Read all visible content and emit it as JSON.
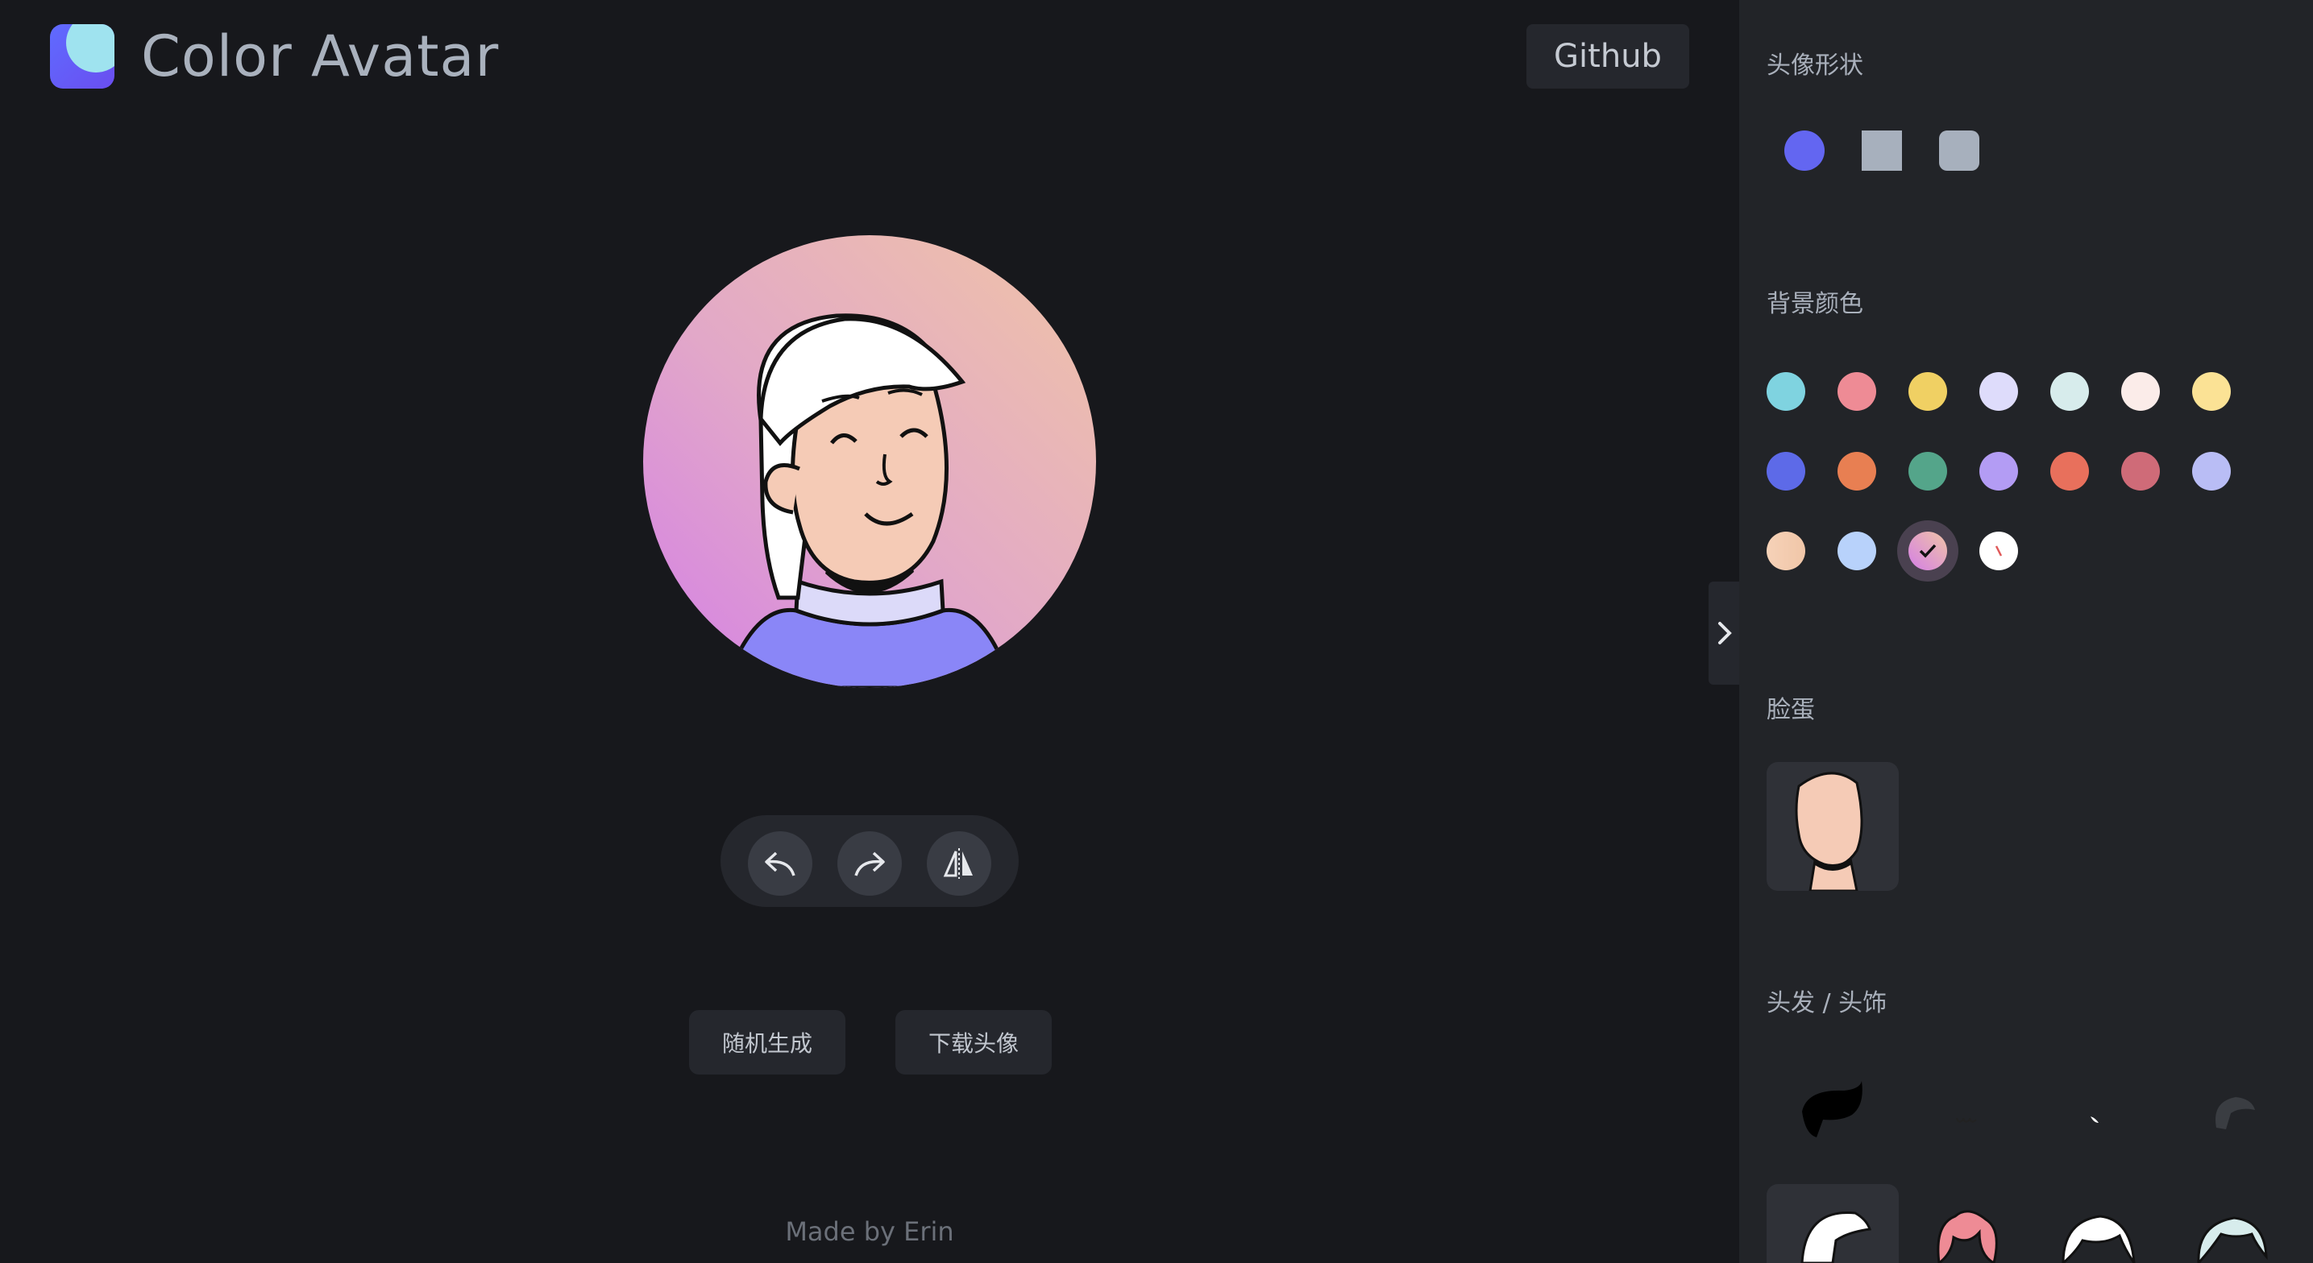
{
  "app": {
    "title": "Color Avatar",
    "github_label": "Github"
  },
  "actions": {
    "random_label": "随机生成",
    "download_label": "下载头像"
  },
  "toolbar": {
    "icons": [
      "undo-icon",
      "redo-icon",
      "flip-icon"
    ]
  },
  "footer": {
    "text": "Made by Erin"
  },
  "panel": {
    "shape_title": "头像形状",
    "shapes": [
      "circle",
      "square",
      "rounded-square"
    ],
    "selected_shape": "circle",
    "background_title": "背景颜色",
    "background_colors": [
      [
        "#7fd3e0",
        "#ee8b95",
        "#f0d063",
        "#dedcfb",
        "#d7ecec",
        "#fbece9",
        "#fbe295"
      ],
      [
        "#5d6ae8",
        "#e87f52",
        "#54a58a",
        "#b39cf4",
        "#e8705c",
        "#cf6b78",
        "#b9bdf5"
      ],
      [
        "gradient-peach",
        "#b8d2fb",
        "gradient-pink-selected",
        "transparent-white"
      ]
    ],
    "face_title": "脸蛋",
    "hair_title": "头发 / 头饰"
  },
  "colors": {
    "accent": "#6366f1",
    "bg": "#17181c",
    "panel": "#222428",
    "button": "#25272d"
  }
}
